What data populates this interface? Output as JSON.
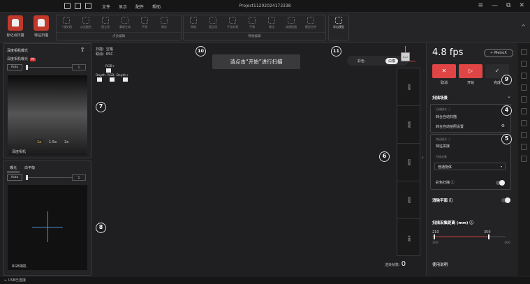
{
  "menubar": {
    "menus": [
      "文件",
      "显示",
      "配件",
      "帮助"
    ],
    "project_title": "Project11202024173338",
    "window_controls": [
      "≡",
      "—",
      "⧉",
      "✕"
    ]
  },
  "ribbon": {
    "modes": [
      {
        "label": "标记点扫描",
        "icon": "marker-scan-icon"
      },
      {
        "label": "特征扫描",
        "icon": "feature-scan-icon"
      }
    ],
    "groups": [
      {
        "label": "点云编辑",
        "tools": [
          "一键处理",
          "点云融合",
          "孤立项",
          "重新生成",
          "平滑",
          "简化"
        ]
      },
      {
        "label": "网格编辑",
        "tools": [
          "网格",
          "孤立项",
          "手动补洞",
          "平滑",
          "简化",
          "纹理贴图",
          "模型合并"
        ]
      },
      {
        "label": "",
        "tools": [
          "导出模型"
        ]
      }
    ]
  },
  "depth_card": {
    "title": "深度相机曝光",
    "subtitle": "深度相机曝光",
    "badge": "M",
    "auto_label": "Auto",
    "value": "1",
    "zoom": [
      "1x",
      "1.5x",
      "2x"
    ],
    "view_label": "深度相机"
  },
  "rgb_card": {
    "tabs": [
      "曝光",
      "白平衡"
    ],
    "auto_label": "Auto",
    "value": "1",
    "view_label": "RGB相机"
  },
  "viewport": {
    "info_lines": [
      "扫描：空格",
      "取消：ESC"
    ],
    "key_labels": "RGB+",
    "key_labels2": "Depth- RGB- Depth+",
    "toast": "请点击“开始”进行扫描",
    "render_modes": [
      "彩色",
      "白模"
    ],
    "gizmo_label": "Front",
    "strip_labels": [
      "主视",
      "俯视",
      "前视",
      "后视",
      "主视"
    ],
    "frame_label": "渲染帧数:",
    "frame_value": "0"
  },
  "right_panel": {
    "fps": "4.8 fps",
    "device": "MetroX",
    "controls": [
      {
        "icon": "✕",
        "label": "取消"
      },
      {
        "icon": "▷",
        "label": "开始"
      },
      {
        "icon": "✓",
        "label": "完成"
      }
    ],
    "scan_scene_title": "扫描场景",
    "scan_mode_label": "扫描模式 ⓘ",
    "scan_mode_value": "转台自动扫描",
    "turntable_label": "转台自动拍照设置",
    "feature_label": "特征模式 ⓘ",
    "feature_value": "特征拼接",
    "object_label": "扫描对象",
    "object_value": "普通物体",
    "color_scan_label": "彩色扫描 ⓘ",
    "remove_plane_label": "消除平面 ⓘ",
    "distance_title": "扫描采集距离 (mm) ⓘ",
    "distance_min": "210",
    "distance_max": "350",
    "range_low": "200",
    "range_high": "400",
    "help_label": "使用说明"
  },
  "annotations": [
    "7",
    "8",
    "10",
    "11",
    "6",
    "4",
    "5",
    "9"
  ],
  "status": {
    "text": "USB已连接"
  }
}
